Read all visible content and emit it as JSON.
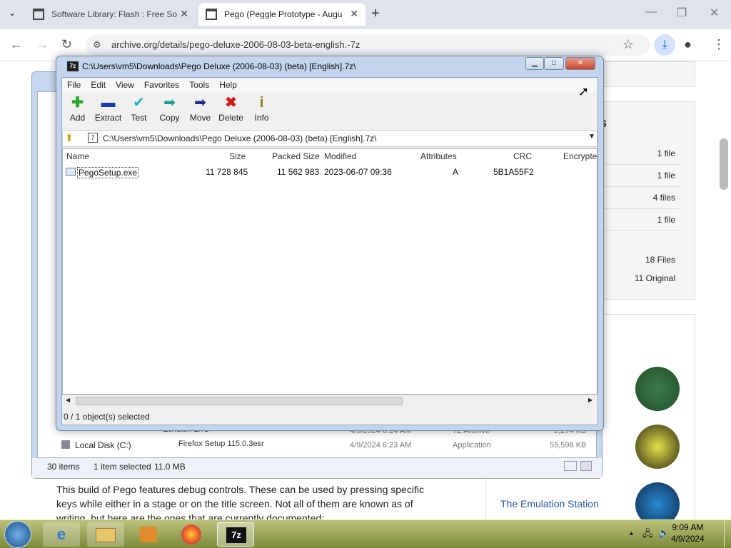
{
  "browser": {
    "tabs": [
      {
        "label": "Software Library: Flash : Free So"
      },
      {
        "label": "Pego (Peggle Prototype - Augu"
      }
    ],
    "url": "archive.org/details/pego-deluxe-2006-08-03-beta-english.-7z"
  },
  "page": {
    "file_counts": [
      "1 file",
      "1 file",
      "4 files",
      "1 file"
    ],
    "summary": [
      "18 Files",
      "11 Original"
    ],
    "related_link": "The Emulation Station",
    "paragraph": "This build of Pego features debug controls. These can be used by pressing specific keys while either in a stage or on the title screen. Not all of them are known as of writing, but here are the ones that are currently documented:"
  },
  "explorer": {
    "nav_item": "Local Disk (C:)",
    "status_items": "30 items",
    "status_selected": "1 item selected",
    "status_size": "11.0 MB",
    "behind_rows": [
      {
        "name": "Echelon-1.7z",
        "date": "4/9/2024 6:24 AM",
        "type": "7Z Archive",
        "size": "2,274 KB"
      },
      {
        "name": "Firefox Setup 115.0.3esr",
        "date": "4/9/2024 6:23 AM",
        "type": "Application",
        "size": "55,598 KB"
      }
    ]
  },
  "sevenzip": {
    "title": "C:\\Users\\vm5\\Downloads\\Pego Deluxe (2006-08-03) (beta) [English].7z\\",
    "menu": [
      "File",
      "Edit",
      "View",
      "Favorites",
      "Tools",
      "Help"
    ],
    "tools": [
      "Add",
      "Extract",
      "Test",
      "Copy",
      "Move",
      "Delete",
      "Info"
    ],
    "path": "C:\\Users\\vm5\\Downloads\\Pego Deluxe (2006-08-03) (beta) [English].7z\\",
    "columns": [
      "Name",
      "Size",
      "Packed Size",
      "Modified",
      "Attributes",
      "CRC",
      "Encrypte"
    ],
    "files": [
      {
        "name": "PegoSetup.exe",
        "size": "11 728 845",
        "packed": "11 562 983",
        "modified": "2023-06-07 09:36",
        "attributes": "A",
        "crc": "5B1A55F2"
      }
    ],
    "status": "0 / 1 object(s) selected"
  },
  "taskbar": {
    "time": "9:09 AM",
    "date": "4/9/2024"
  },
  "colors": {
    "chrome_tab_bg": "#dfe3ec",
    "taskbar": "#9aa64e",
    "sz_frame": "#c3d5ec"
  }
}
